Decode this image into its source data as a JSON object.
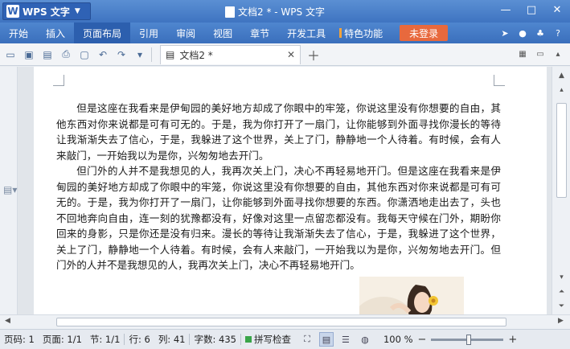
{
  "app": {
    "name": "WPS 文字",
    "logo": "W"
  },
  "window": {
    "title": "文档2 * - WPS 文字"
  },
  "menu": {
    "items": [
      "开始",
      "插入",
      "页面布局",
      "引用",
      "审阅",
      "视图",
      "章节",
      "开发工具"
    ],
    "active_index": 2,
    "special": "特色功能",
    "login": "未登录"
  },
  "tab": {
    "label": "文档2 *"
  },
  "document": {
    "paragraphs": [
      "但是这座在我看来是伊甸园的美好地方却成了你眼中的牢笼，你说这里没有你想要的自由，其他东西对你来说都是可有可无的。于是，我为你打开了一扇门，让你能够到外面寻找你漫长的等待让我渐渐失去了信心，于是，我躲进了这个世界，关上了门，静静地一个人待着。有时候，会有人来敲门，一开始我以为是你，兴匆匆地去开门。",
      "但门外的人并不是我想见的人，我再次关上门，决心不再轻易地开门。但是这座在我看来是伊甸园的美好地方却成了你眼中的牢笼，你说这里没有你想要的自由，其他东西对你来说都是可有可无的。于是，我为你打开了一扇门，让你能够到外面寻找你想要的东西。你潇洒地走出去了，头也不回地奔向自由，连一刻的犹豫都没有，好像对这里一点留恋都没有。我每天守候在门外，期盼你回来的身影，只是你还是没有归来。漫长的等待让我渐渐失去了信心，于是，我躲进了这个世界，关上了门，静静地一个人待着。有时候，会有人来敲门，一开始我以为是你，兴匆匆地去开门。但门外的人并不是我想见的人，我再次关上门，决心不再轻易地开门。"
    ]
  },
  "status": {
    "page_no": "页码: 1",
    "pages": "页面: 1/1",
    "section": "节: 1/1",
    "row": "行: 6",
    "col": "列: 41",
    "chars": "字数: 435",
    "spell": "拼写检查",
    "zoom": "100 %"
  },
  "colors": {
    "accent": "#3f74c1",
    "login": "#e8693d",
    "special_bar": "#f3a33b"
  }
}
